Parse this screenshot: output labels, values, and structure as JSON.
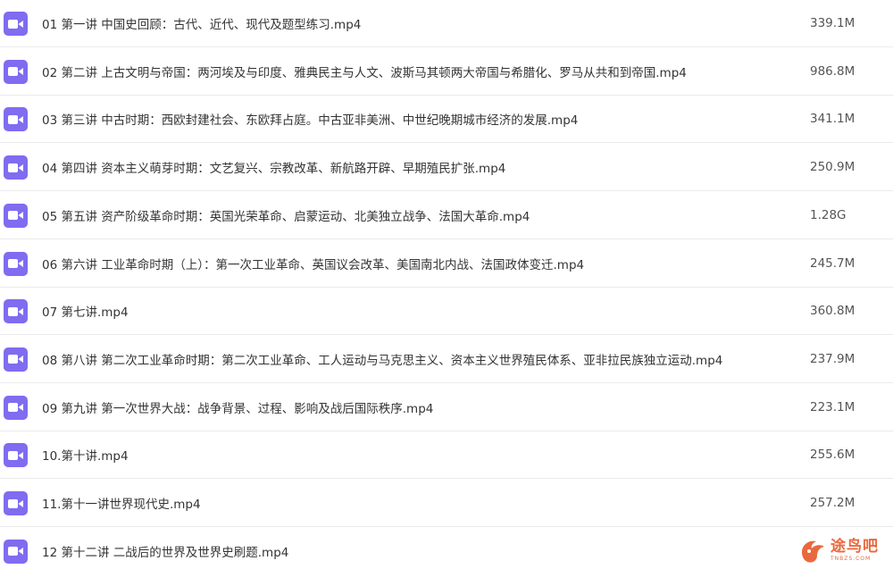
{
  "theme": {
    "icon_color": "#7f6cf0"
  },
  "files": [
    {
      "name": "01 第一讲 中国史回顾：古代、近代、现代及题型练习.mp4",
      "size": "339.1M",
      "icon": "video-icon"
    },
    {
      "name": "02 第二讲 上古文明与帝国：两河埃及与印度、雅典民主与人文、波斯马其顿两大帝国与希腊化、罗马从共和到帝国.mp4",
      "size": "986.8M",
      "icon": "video-icon"
    },
    {
      "name": "03 第三讲 中古时期：西欧封建社会、东欧拜占庭。中古亚非美洲、中世纪晚期城市经济的发展.mp4",
      "size": "341.1M",
      "icon": "video-icon"
    },
    {
      "name": "04 第四讲 资本主义萌芽时期：文艺复兴、宗教改革、新航路开辟、早期殖民扩张.mp4",
      "size": "250.9M",
      "icon": "video-icon"
    },
    {
      "name": "05 第五讲 资产阶级革命时期：英国光荣革命、启蒙运动、北美独立战争、法国大革命.mp4",
      "size": "1.28G",
      "icon": "video-icon"
    },
    {
      "name": "06 第六讲 工业革命时期（上）：第一次工业革命、英国议会改革、美国南北内战、法国政体变迁.mp4",
      "size": "245.7M",
      "icon": "video-icon"
    },
    {
      "name": "07 第七讲.mp4",
      "size": "360.8M",
      "icon": "video-icon"
    },
    {
      "name": "08 第八讲 第二次工业革命时期：第二次工业革命、工人运动与马克思主义、资本主义世界殖民体系、亚非拉民族独立运动.mp4",
      "size": "237.9M",
      "icon": "video-icon"
    },
    {
      "name": "09 第九讲 第一次世界大战：战争背景、过程、影响及战后国际秩序.mp4",
      "size": "223.1M",
      "icon": "video-icon"
    },
    {
      "name": "10.第十讲.mp4",
      "size": "255.6M",
      "icon": "video-icon"
    },
    {
      "name": "11.第十一讲世界现代史.mp4",
      "size": "257.2M",
      "icon": "video-icon"
    },
    {
      "name": "12 第十二讲 二战后的世界及世界史刷题.mp4",
      "size": "",
      "icon": "video-icon"
    }
  ],
  "watermark": {
    "text": "途鸟吧",
    "subtext": "TNBZS.COM",
    "color": "#e8582a"
  }
}
